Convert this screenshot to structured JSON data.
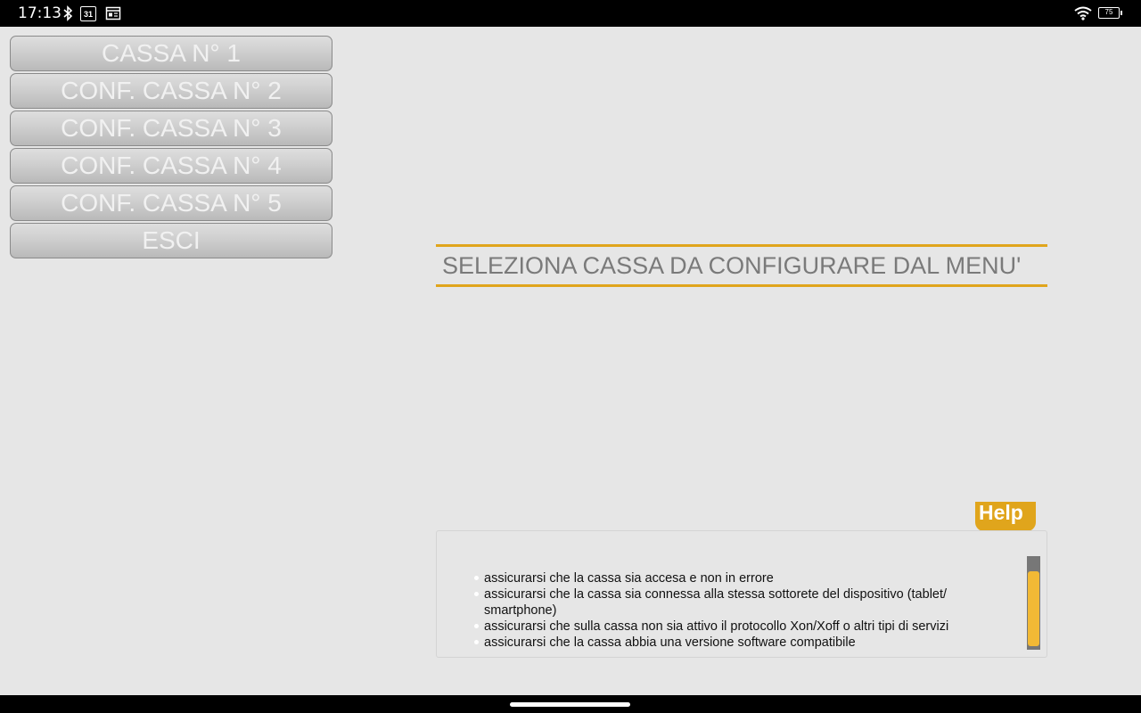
{
  "status_bar": {
    "time": "17:13",
    "calendar_day": "31",
    "battery_level": "75",
    "icons": [
      "bluetooth-icon",
      "calendar-icon",
      "news-icon",
      "wifi-icon",
      "battery-icon"
    ]
  },
  "menu": {
    "items": [
      {
        "label": "CASSA N° 1"
      },
      {
        "label": "CONF. CASSA N° 2"
      },
      {
        "label": "CONF. CASSA N° 3"
      },
      {
        "label": "CONF. CASSA N° 4"
      },
      {
        "label": "CONF. CASSA N° 5"
      },
      {
        "label": "ESCI"
      }
    ]
  },
  "main": {
    "prompt": "SELEZIONA CASSA DA CONFIGURARE DAL MENU'"
  },
  "help": {
    "tab_label": "Help",
    "items": [
      "assicurarsi che la cassa sia accesa e non in errore",
      "assicurarsi che la cassa sia connessa alla stessa sottorete del dispositivo (tablet/ smartphone)",
      "assicurarsi che sulla cassa non sia attivo il protocollo Xon/Xoff o altri tipi di servizi",
      "assicurarsi che la cassa abbia una versione software compatibile"
    ]
  },
  "colors": {
    "accent": "#e0a51c",
    "scroll_thumb": "#f2b935",
    "background": "#e6e6e6",
    "button_text": "#f1f1f1"
  }
}
